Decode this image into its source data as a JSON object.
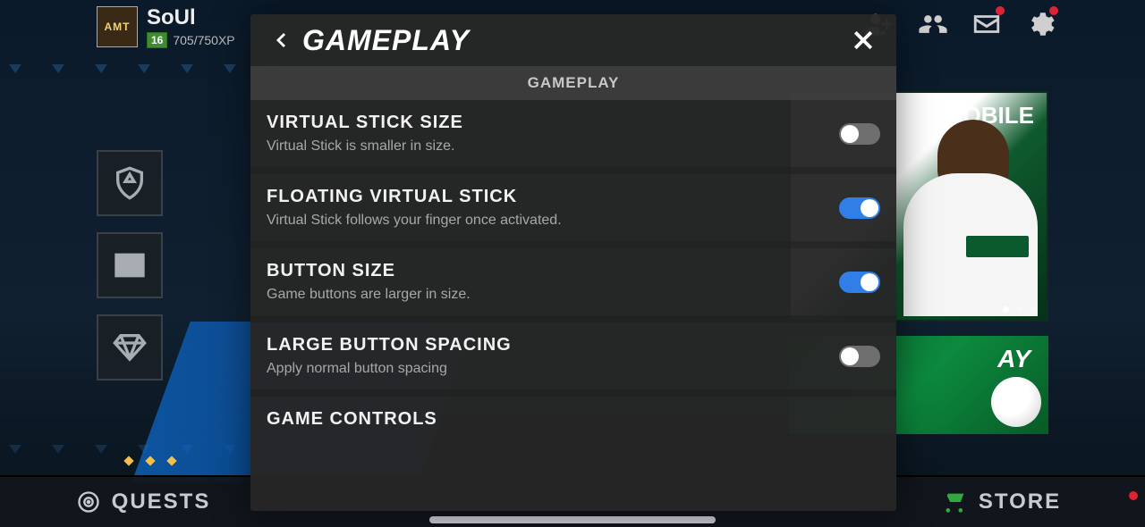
{
  "user": {
    "name": "SoUl",
    "level": "16",
    "xp": "705/750XP",
    "avatar_label": "AMT"
  },
  "modal": {
    "title": "GAMEPLAY",
    "section": "GAMEPLAY",
    "options": [
      {
        "title": "VIRTUAL STICK SIZE",
        "desc": "Virtual Stick is smaller in size.",
        "on": false
      },
      {
        "title": "FLOATING VIRTUAL STICK",
        "desc": "Virtual Stick follows your finger once activated.",
        "on": true
      },
      {
        "title": "BUTTON SIZE",
        "desc": "Game buttons are larger in size.",
        "on": true
      },
      {
        "title": "LARGE BUTTON SPACING",
        "desc": "Apply normal button spacing",
        "on": false
      },
      {
        "title": "GAME CONTROLS",
        "desc": ""
      }
    ]
  },
  "nav": {
    "left": "QUESTS",
    "right": "STORE"
  },
  "promo": {
    "tile1": "MOBILE",
    "tile2": "AY"
  }
}
